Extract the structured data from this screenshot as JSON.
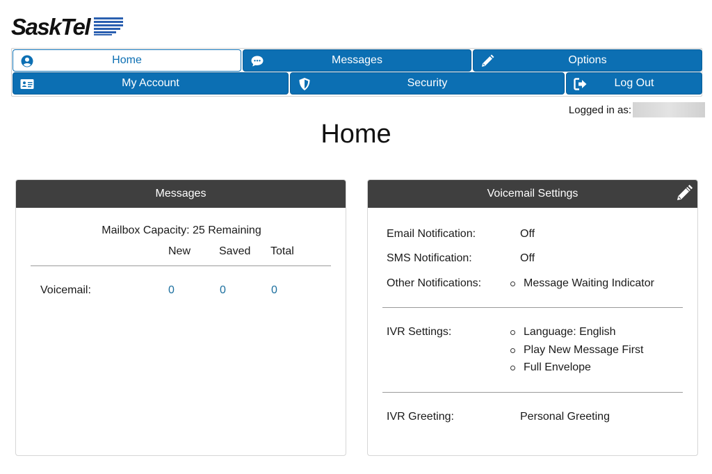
{
  "brand": {
    "name": "SaskTel",
    "accent": "#0c6fb3"
  },
  "nav": {
    "row1": [
      {
        "label": "Home",
        "icon": "user-circle-icon",
        "active": true
      },
      {
        "label": "Messages",
        "icon": "chat-bubble-icon",
        "active": false
      },
      {
        "label": "Options",
        "icon": "pencil-icon",
        "active": false
      }
    ],
    "row2": [
      {
        "label": "My Account",
        "icon": "id-card-icon"
      },
      {
        "label": "Security",
        "icon": "shield-icon"
      },
      {
        "label": "Log Out",
        "icon": "sign-out-icon"
      }
    ]
  },
  "logged_in_label": "Logged in as:",
  "page_title": "Home",
  "messages_panel": {
    "title": "Messages",
    "capacity": "Mailbox Capacity: 25 Remaining",
    "columns": [
      "New",
      "Saved",
      "Total"
    ],
    "rows": [
      {
        "label": "Voicemail:",
        "values": [
          "0",
          "0",
          "0"
        ]
      }
    ]
  },
  "voicemail_panel": {
    "title": "Voicemail Settings",
    "email_label": "Email Notification:",
    "email_value": "Off",
    "sms_label": "SMS Notification:",
    "sms_value": "Off",
    "other_label": "Other Notifications:",
    "other_items": [
      "Message Waiting Indicator"
    ],
    "ivr_label": "IVR Settings:",
    "ivr_items": [
      "Language: English",
      "Play New Message First",
      "Full Envelope"
    ],
    "greeting_label": "IVR Greeting:",
    "greeting_value": "Personal Greeting"
  }
}
